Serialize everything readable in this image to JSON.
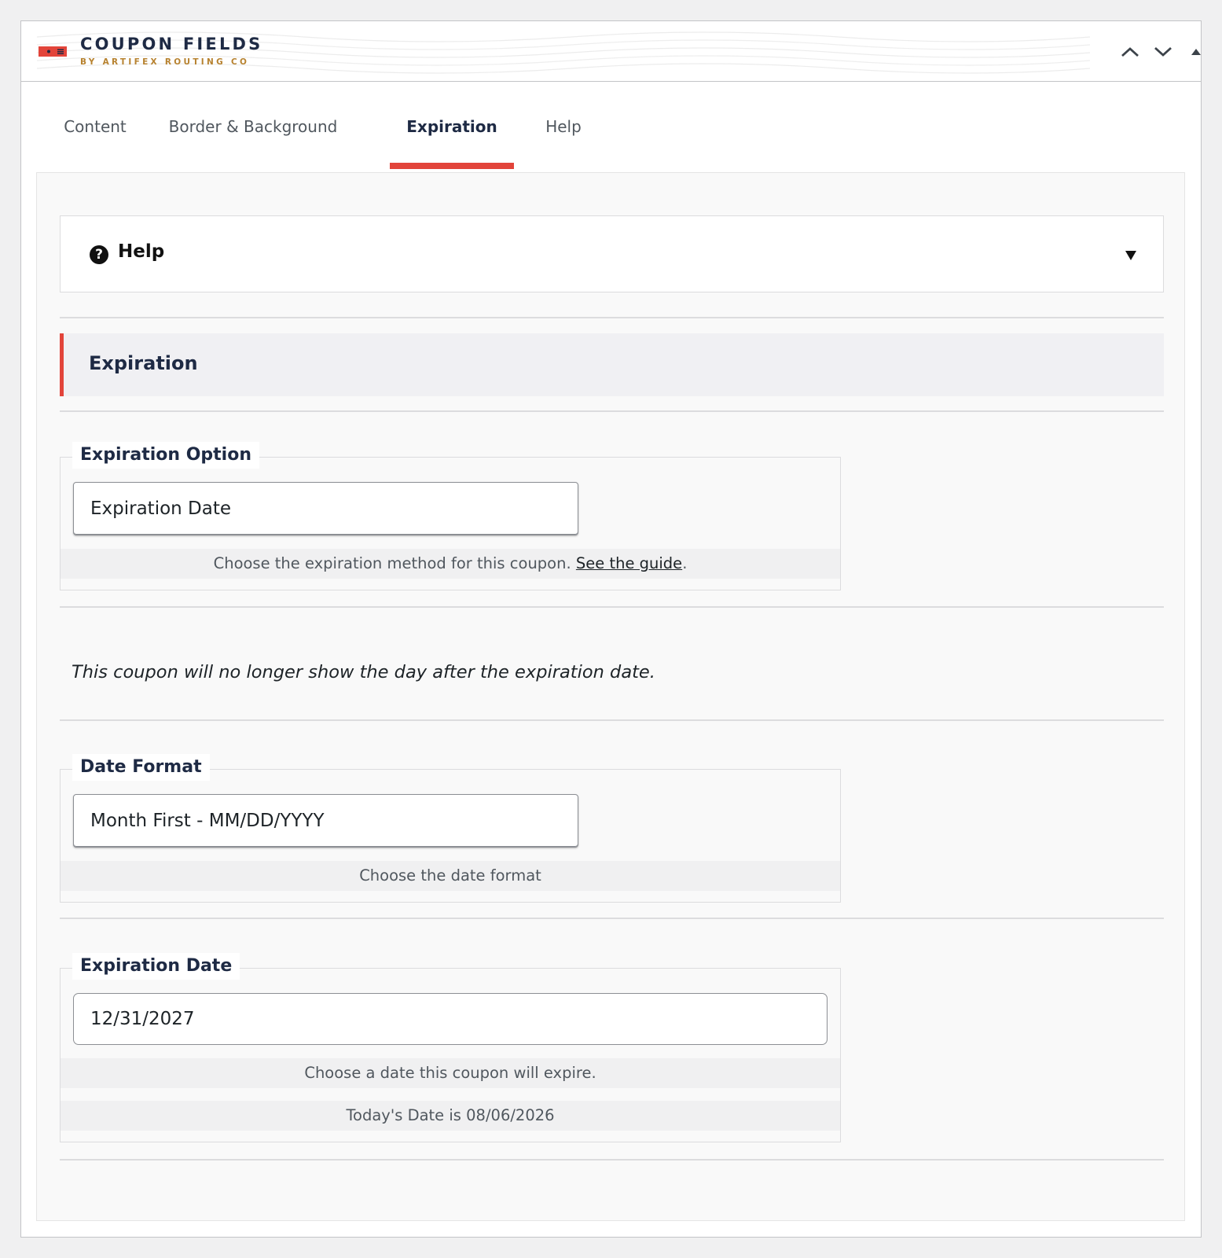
{
  "header": {
    "title": "COUPON FIELDS",
    "subtitle": "BY ARTIFEX ROUTING CO",
    "logo_color": "#e2443a",
    "controls": [
      "chevron-up-icon",
      "chevron-down-icon",
      "triangle-up-icon"
    ]
  },
  "tabs": [
    {
      "label": "Content",
      "active": false
    },
    {
      "label": "Border & Background",
      "active": false
    },
    {
      "label": "Expiration",
      "active": true
    },
    {
      "label": "Help",
      "active": false
    }
  ],
  "help": {
    "icon": "question-circle-icon",
    "title": "Help",
    "caret": "caret-down-icon"
  },
  "section": {
    "title": "Expiration",
    "accent": "#e2443a"
  },
  "fields": {
    "expiration_option": {
      "legend": "Expiration Option",
      "value": "Expiration Date",
      "desc_text": "Choose the expiration method for this coupon.",
      "desc_link": "See the guide",
      "desc_suffix": "."
    },
    "note": "This coupon will no longer show the day after the expiration date.",
    "date_format": {
      "legend": "Date Format",
      "value": "Month First - MM/DD/YYYY",
      "desc": "Choose the date format"
    },
    "expiration_date": {
      "legend": "Expiration Date",
      "value": "12/31/2027",
      "desc": "Choose a date this coupon will expire.",
      "today": "Today's Date is 08/06/2026"
    }
  }
}
